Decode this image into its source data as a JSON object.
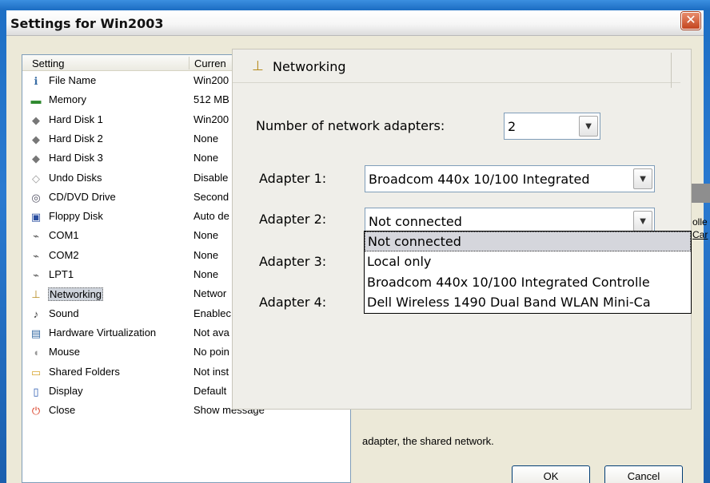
{
  "window": {
    "title": "Settings for Win2003"
  },
  "list": {
    "col_setting": "Setting",
    "col_current": "Curren",
    "items": [
      {
        "label": "File Name",
        "value": "Win200",
        "icon": "info-icon"
      },
      {
        "label": "Memory",
        "value": "512 MB",
        "icon": "memory-icon"
      },
      {
        "label": "Hard Disk 1",
        "value": "Win200",
        "icon": "hard-disk-icon"
      },
      {
        "label": "Hard Disk 2",
        "value": "None",
        "icon": "hard-disk-icon"
      },
      {
        "label": "Hard Disk 3",
        "value": "None",
        "icon": "hard-disk-icon"
      },
      {
        "label": "Undo Disks",
        "value": "Disable",
        "icon": "undo-disk-icon"
      },
      {
        "label": "CD/DVD Drive",
        "value": "Second",
        "icon": "cd-icon"
      },
      {
        "label": "Floppy Disk",
        "value": "Auto de",
        "icon": "floppy-icon"
      },
      {
        "label": "COM1",
        "value": "None",
        "icon": "port-icon"
      },
      {
        "label": "COM2",
        "value": "None",
        "icon": "port-icon"
      },
      {
        "label": "LPT1",
        "value": "None",
        "icon": "port-icon"
      },
      {
        "label": "Networking",
        "value": "Networ",
        "icon": "network-icon"
      },
      {
        "label": "Sound",
        "value": "Enablec",
        "icon": "sound-icon"
      },
      {
        "label": "Hardware Virtualization",
        "value": "Not ava",
        "icon": "hardware-icon"
      },
      {
        "label": "Mouse",
        "value": "No poin",
        "icon": "mouse-icon"
      },
      {
        "label": "Shared Folders",
        "value": "Not inst",
        "icon": "folder-icon"
      },
      {
        "label": "Display",
        "value": "Default",
        "icon": "display-icon"
      },
      {
        "label": "Close",
        "value": "Show message",
        "icon": "close-power-icon"
      }
    ]
  },
  "panel": {
    "title": "Networking",
    "num_adapters_label": "Number of network adapters:",
    "num_adapters_value": "2",
    "adapter1_label": "Adapter 1:",
    "adapter1_value": "Broadcom 440x 10/100 Integrated",
    "adapter2_label": "Adapter 2:",
    "adapter2_value": "Not connected",
    "adapter3_label": "Adapter 3:",
    "adapter4_label": "Adapter 4:"
  },
  "dropdown": {
    "options": [
      "Not connected",
      "Local only",
      "Broadcom 440x 10/100 Integrated Controlle",
      "Dell Wireless 1490 Dual Band WLAN Mini-Ca"
    ]
  },
  "behind": {
    "text_olle": "olle",
    "text_car": "Car",
    "description": "adapter, the shared network."
  },
  "buttons": {
    "ok": "OK",
    "cancel": "Cancel"
  }
}
